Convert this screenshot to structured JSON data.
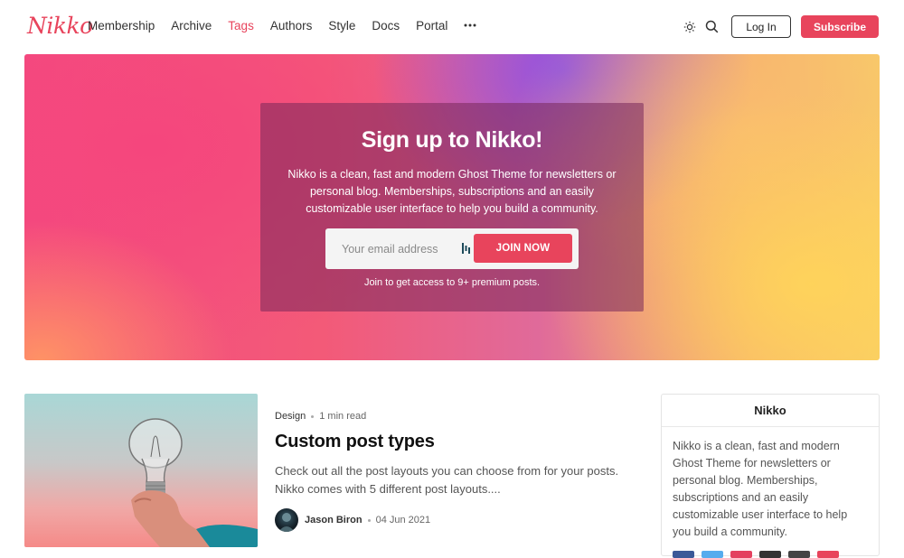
{
  "brand": {
    "logo": "Nikko",
    "accent": "#e8445c"
  },
  "nav": {
    "items": [
      {
        "label": "Membership"
      },
      {
        "label": "Archive"
      },
      {
        "label": "Tags",
        "active": true
      },
      {
        "label": "Authors"
      },
      {
        "label": "Style"
      },
      {
        "label": "Docs"
      },
      {
        "label": "Portal"
      }
    ],
    "more_icon": "more-horizontal-icon"
  },
  "header_actions": {
    "theme_icon": "sun-icon",
    "search_icon": "search-icon",
    "login_label": "Log In",
    "subscribe_label": "Subscribe"
  },
  "hero": {
    "title": "Sign up to Nikko!",
    "description": "Nikko is a clean, fast and modern Ghost Theme for newsletters or personal blog. Memberships, subscriptions and an easily customizable user interface to help you build a community.",
    "email_placeholder": "Your email address",
    "join_label": "JOIN NOW",
    "note": "Join to get access to 9+ premium posts."
  },
  "post": {
    "tag": "Design",
    "read_time": "1 min read",
    "title": "Custom post types",
    "excerpt": "Check out all the post layouts you can choose from for your posts. Nikko comes with 5 different post layouts....",
    "author": "Jason Biron",
    "date": "04 Jun 2021"
  },
  "sidebar": {
    "title": "Nikko",
    "text": "Nikko is a clean, fast and modern Ghost Theme for newsletters or personal blog. Memberships, subscriptions and an easily customizable user interface to help you build a community.",
    "social_colors": [
      "#3b5998",
      "#55acee",
      "#e4405f",
      "#333333",
      "#444444",
      "#e8445c"
    ]
  }
}
